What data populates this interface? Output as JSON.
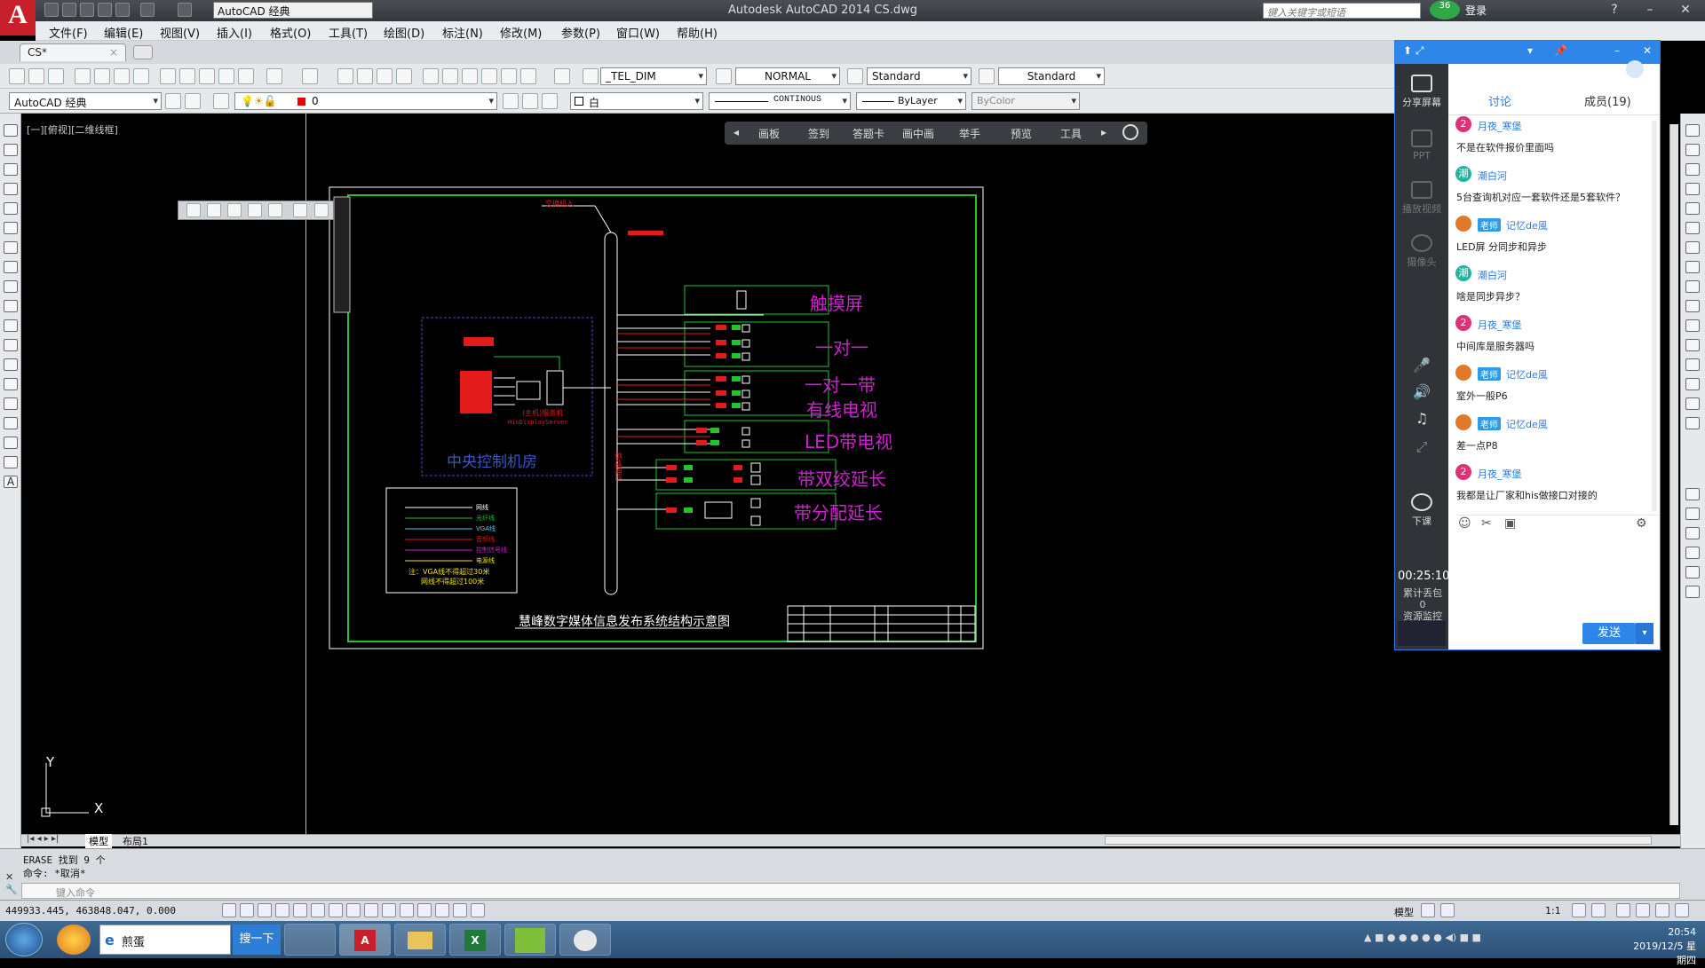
{
  "window": {
    "title": "Autodesk AutoCAD 2014    CS.dwg",
    "app_button": "A",
    "workspace": "AutoCAD 经典",
    "search_placeholder": "键入关键字或短语",
    "login": "登录",
    "badge": "36"
  },
  "menu": [
    "文件(F)",
    "编辑(E)",
    "视图(V)",
    "插入(I)",
    "格式(O)",
    "工具(T)",
    "绘图(D)",
    "标注(N)",
    "修改(M)",
    "参数(P)",
    "窗口(W)",
    "帮助(H)"
  ],
  "doc_tab": "CS*",
  "styles": {
    "text_style": "_TEL_DIM",
    "dim_style": "NORMAL",
    "table_style": "Standard",
    "mleader_style": "Standard"
  },
  "layers": {
    "workspace": "AutoCAD 经典",
    "current_layer": "0",
    "color": "白",
    "linetype": "CONTINOUS",
    "lineweight": "ByLayer",
    "plotstyle": "ByColor"
  },
  "viewport_label": "[一][俯视][二维线框]",
  "float_bar": [
    "画板",
    "签到",
    "答题卡",
    "画中画",
    "举手",
    "预览",
    "工具"
  ],
  "drawing": {
    "title": "慧峰数字媒体信息发布系统结构示意图",
    "control_room": "中央控制机房",
    "server_label": "(主机)服务机",
    "server_sub": "HisDisplayServer",
    "backbone_label": "局域网络",
    "top_tag": "交换机入",
    "groups": [
      "触摸屏",
      "一对一",
      "一对一带",
      "有线电视",
      "LED带电视",
      "带双绞延长",
      "带分配延长"
    ],
    "legend_items": [
      "网线",
      "光纤线",
      "VGA线",
      "音频线",
      "控制信号线",
      "电源线"
    ],
    "legend_note_1": "注：VGA线不得超过30米",
    "legend_note_2": "网线不得超过100米"
  },
  "ucs": {
    "y": "Y",
    "x": "X"
  },
  "layout_tabs": [
    "模型",
    "布局1"
  ],
  "command": {
    "line1": "ERASE 找到 9 个",
    "line2": "命令: *取消*",
    "placeholder": "键入命令"
  },
  "status": {
    "coords": "449933.445, 463848.047, 0.000",
    "model": "模型",
    "scale": "1:1"
  },
  "chat": {
    "tabs": [
      "讨论",
      "成员(19)"
    ],
    "side": [
      "分享屏幕",
      "PPT",
      "播放视频",
      "摄像头",
      "下课"
    ],
    "timer": "00:25:10",
    "stat1": "累计丢包",
    "stat2": "0",
    "stat3": "资源监控",
    "messages": [
      {
        "name": "月夜_寒堡",
        "avatar": "2",
        "teacher": false,
        "text": "不是在软件报价里面吗"
      },
      {
        "name": "潮白河",
        "avatar": "潮",
        "teacher": false,
        "text": "5台查询机对应一套软件还是5套软件？"
      },
      {
        "name": "记忆de風",
        "avatar": "",
        "teacher": true,
        "text": "LED屏 分同步和异步"
      },
      {
        "name": "潮白河",
        "avatar": "潮",
        "teacher": false,
        "text": "啥是同步异步？"
      },
      {
        "name": "月夜_寒堡",
        "avatar": "2",
        "teacher": false,
        "text": "中间库是服务器吗"
      },
      {
        "name": "记忆de風",
        "avatar": "",
        "teacher": true,
        "text": "室外一般P6"
      },
      {
        "name": "记忆de風",
        "avatar": "",
        "teacher": true,
        "text": "差一点P8"
      },
      {
        "name": "月夜_寒堡",
        "avatar": "2",
        "teacher": false,
        "text": "我都是让厂家和his做接口对接的"
      }
    ],
    "teacher_tag": "老师",
    "send": "发送"
  },
  "taskbar": {
    "ie_text": "煎蛋",
    "search_btn": "搜一下",
    "time": "20:54",
    "date": "2019/12/5 星期四"
  },
  "colors": {
    "accent": "#2e86e8",
    "drawing_frame": "#22c32e",
    "magenta": "#d21fd2",
    "red": "#e31b1b"
  }
}
